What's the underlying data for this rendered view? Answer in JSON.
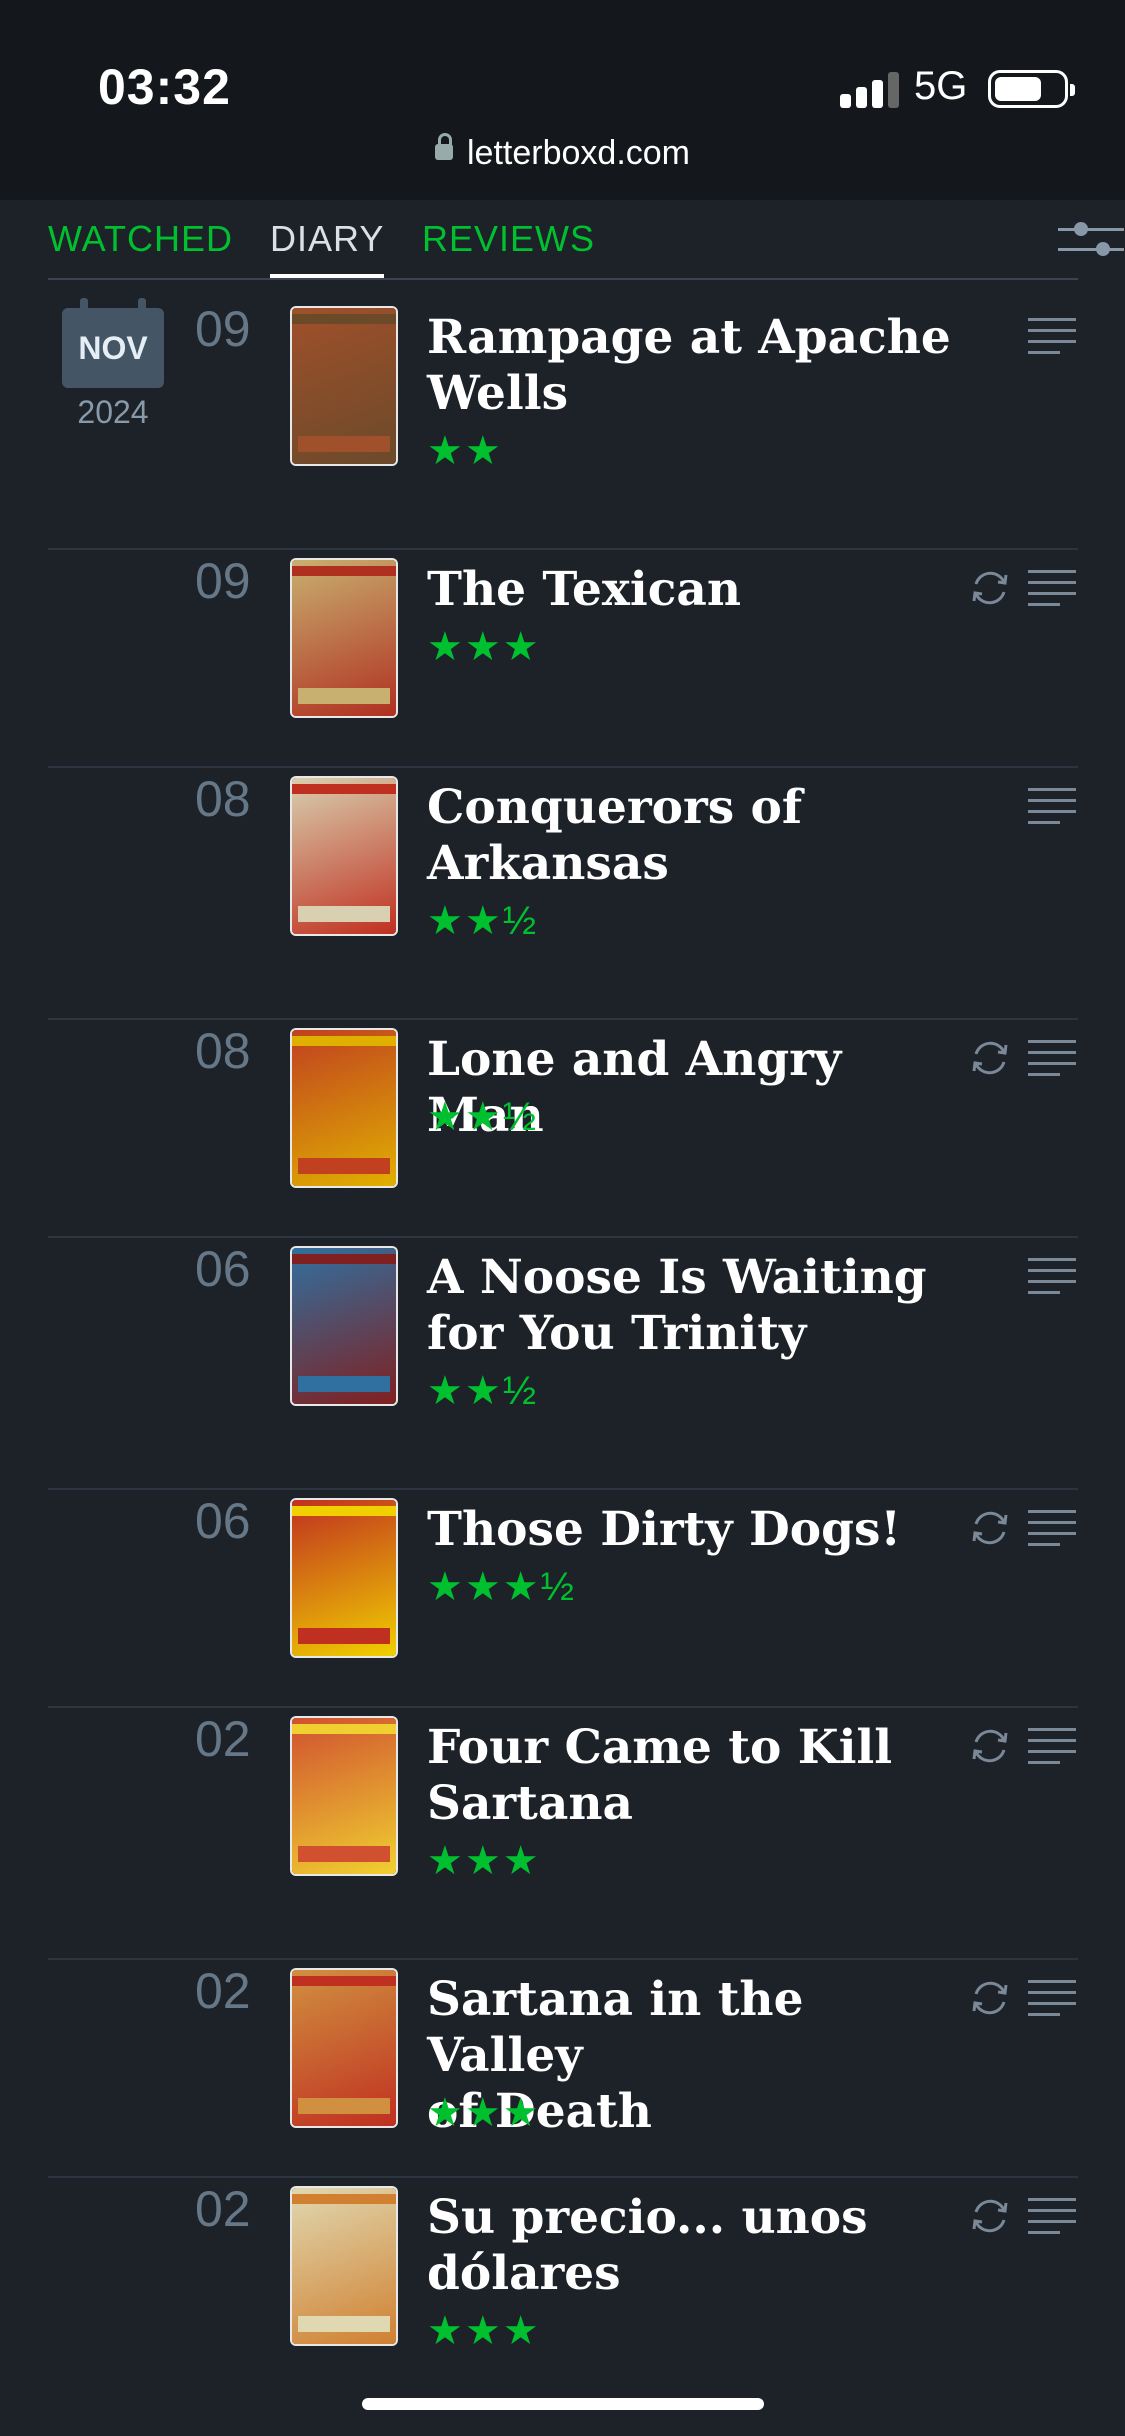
{
  "status": {
    "time": "03:32",
    "network": "5G"
  },
  "browser": {
    "url": "letterboxd.com"
  },
  "tabs": [
    {
      "label": "WATCHED",
      "active": false
    },
    {
      "label": "DIARY",
      "active": true
    },
    {
      "label": "REVIEWS",
      "active": false
    }
  ],
  "month": {
    "name": "NOV",
    "year": "2024"
  },
  "entries": [
    {
      "day": "09",
      "title_lines": [
        "Rampage at Apache",
        "Wells"
      ],
      "rating": "★★",
      "rewatch": false,
      "poster": [
        "#a0502a",
        "#6b4a2a"
      ]
    },
    {
      "day": "09",
      "title_lines": [
        "The Texican"
      ],
      "rating": "★★★",
      "rewatch": true,
      "poster": [
        "#c8b070",
        "#b03020"
      ]
    },
    {
      "day": "08",
      "title_lines": [
        "Conquerors of",
        "Arkansas"
      ],
      "rating": "★★½",
      "rewatch": false,
      "poster": [
        "#d8d0b0",
        "#c03020"
      ]
    },
    {
      "day": "08",
      "title_lines": [
        "Lone and Angry Man"
      ],
      "rating": "★★½",
      "rewatch": true,
      "poster": [
        "#c04020",
        "#e0b000"
      ]
    },
    {
      "day": "06",
      "title_lines": [
        "A Noose Is Waiting",
        "for You Trinity"
      ],
      "rating": "★★½",
      "rewatch": false,
      "poster": [
        "#3070a0",
        "#802020"
      ]
    },
    {
      "day": "06",
      "title_lines": [
        "Those Dirty Dogs!"
      ],
      "rating": "★★★½",
      "rewatch": true,
      "poster": [
        "#c03020",
        "#f0d000"
      ]
    },
    {
      "day": "02",
      "title_lines": [
        "Four Came to Kill",
        "Sartana"
      ],
      "rating": "★★★",
      "rewatch": true,
      "poster": [
        "#d05030",
        "#f0d030"
      ]
    },
    {
      "day": "02",
      "title_lines": [
        "Sartana in the Valley",
        "of Death"
      ],
      "rating": "★★★",
      "rewatch": true,
      "poster": [
        "#d09040",
        "#c03020"
      ]
    },
    {
      "day": "02",
      "title_lines": [
        "Su precio... unos",
        "dólares"
      ],
      "rating": "★★★",
      "rewatch": true,
      "poster": [
        "#e0d8b0",
        "#d08030"
      ]
    }
  ]
}
